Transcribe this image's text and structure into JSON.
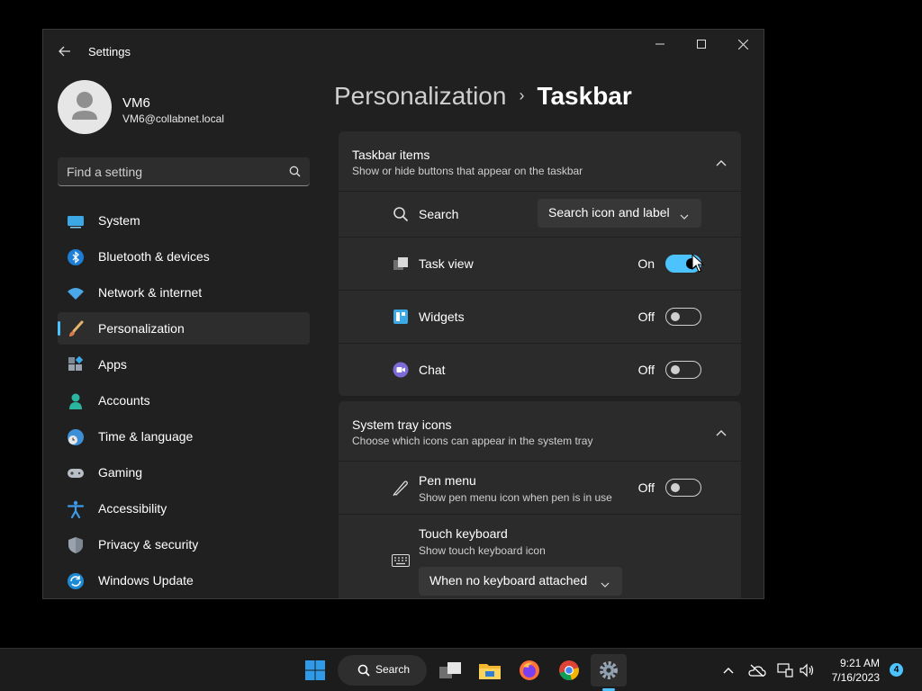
{
  "window": {
    "title": "Settings",
    "back_icon": "arrow-left-icon",
    "controls": [
      "minimize-icon",
      "maximize-icon",
      "close-icon"
    ]
  },
  "profile": {
    "name": "VM6",
    "email": "VM6@collabnet.local"
  },
  "search": {
    "placeholder": "Find a setting"
  },
  "sidebar": {
    "items": [
      {
        "label": "System",
        "icon": "system-icon"
      },
      {
        "label": "Bluetooth & devices",
        "icon": "bluetooth-icon"
      },
      {
        "label": "Network & internet",
        "icon": "wifi-icon"
      },
      {
        "label": "Personalization",
        "icon": "brush-icon",
        "active": true
      },
      {
        "label": "Apps",
        "icon": "apps-icon"
      },
      {
        "label": "Accounts",
        "icon": "person-icon"
      },
      {
        "label": "Time & language",
        "icon": "globe-clock-icon"
      },
      {
        "label": "Gaming",
        "icon": "gamepad-icon"
      },
      {
        "label": "Accessibility",
        "icon": "accessibility-icon"
      },
      {
        "label": "Privacy & security",
        "icon": "shield-icon"
      },
      {
        "label": "Windows Update",
        "icon": "update-icon"
      }
    ]
  },
  "breadcrumb": {
    "parent": "Personalization",
    "separator": "›",
    "current": "Taskbar"
  },
  "taskbar_items": {
    "title": "Taskbar items",
    "subtitle": "Show or hide buttons that appear on the taskbar",
    "search": {
      "label": "Search",
      "value": "Search icon and label"
    },
    "task_view": {
      "label": "Task view",
      "state": "On"
    },
    "widgets": {
      "label": "Widgets",
      "state": "Off"
    },
    "chat": {
      "label": "Chat",
      "state": "Off"
    }
  },
  "system_tray": {
    "title": "System tray icons",
    "subtitle": "Choose which icons can appear in the system tray",
    "pen_menu": {
      "label": "Pen menu",
      "sub": "Show pen menu icon when pen is in use",
      "state": "Off"
    },
    "touch_keyboard": {
      "label": "Touch keyboard",
      "sub": "Show touch keyboard icon",
      "value": "When no keyboard attached"
    }
  },
  "os_taskbar": {
    "search_label": "Search",
    "time": "9:21 AM",
    "date": "7/16/2023",
    "notifications": "4"
  },
  "colors": {
    "accent": "#4cc2ff",
    "window_bg": "#202020",
    "card_bg": "#2b2b2b"
  }
}
